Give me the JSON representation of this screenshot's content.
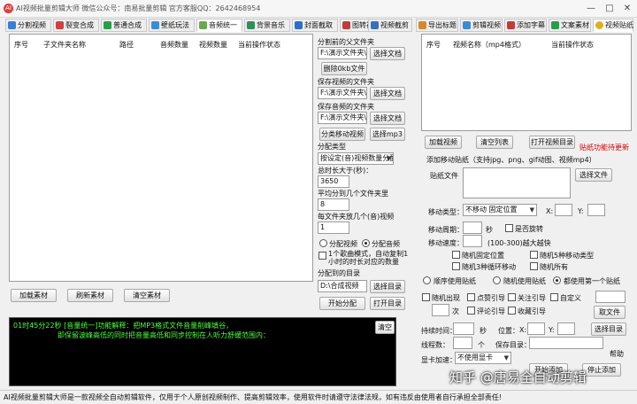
{
  "window": {
    "title": "AI视频批量剪辑大师   微信公众号：南易批量剪辑   官方客服QQ：2642468954",
    "min": "—",
    "max": "□",
    "close": "✕"
  },
  "left_tabs": [
    "分割视频",
    "裂变合成",
    "普通合成",
    "壁纸玩法",
    "音频统一",
    "背景音乐",
    "封面截取",
    "图转视频",
    "视频截剪"
  ],
  "right_tabs": [
    "导出标题",
    "剪辑视频",
    "添加字幕",
    "文案素材",
    "视频贴纸"
  ],
  "file_table": {
    "headers": [
      "序号",
      "子文件夹名称",
      "路径",
      "音频数量",
      "视频数量",
      "当前操作状态"
    ]
  },
  "left_buttons": {
    "add": "加载素材",
    "refresh": "刷新素材",
    "clear": "清空素材"
  },
  "config": {
    "split_folder_label": "分割前的父文件夹",
    "split_folder_value": "F:\\演示文件夹\\割",
    "select": "选择文档",
    "delete_btn": "删除0kb文件",
    "save_video_label": "保存视频的文件夹",
    "save_video_value": "F:\\演示文件夹\\割",
    "save_audio_label": "保存音频的文件夹",
    "save_audio_value": "F:\\演示文件夹\\",
    "classify_btn": "分类移动视频",
    "select_mp3": "选择mp3",
    "split_type_label": "分配类型",
    "split_type_value": "按设定(音)视频数量分配",
    "total_len_label": "总时长大于(秒)：",
    "total_len_value": "3650",
    "avg_label": "平均分到几个文件夹里",
    "avg_value": "8",
    "per_label": "每文件夹放几个(音)视频",
    "per_value": "1",
    "radio_video": "分配视频",
    "radio_audio": "分配音频",
    "mode_note": "1个歌曲模式，自动复制1小时的时长对应的数量",
    "dir_label": "分配到的目录",
    "dir_value": "D:\\合成视频",
    "select_dir": "选择目录",
    "start_btn": "开始分配",
    "open_dir": "打开目录"
  },
  "log": {
    "line1": "01时45分22秒 [音量统一]功能解释：把MP3格式文件音量削峰填谷，",
    "line2": "即保留波峰高低的同时把音量高低和同步控制在人听力舒缓范围内：",
    "clear": "清空"
  },
  "sticker": {
    "headers": [
      "序号",
      "视频名称（mp4格式）",
      "当前操作状态"
    ],
    "load_btn": "加载视频",
    "clear_btn": "清空列表",
    "open_dir_btn": "打开视频目录",
    "notice": "贴纸功能待更新",
    "add_title": "添加移动贴纸（支持jpg、png、gif动图、视频mp4）",
    "sticker_file_label": "贴纸文件",
    "select_file": "选择文件",
    "move_type_label": "移动类型：",
    "move_type_value": "不移动 固定位置",
    "x_label": "X:",
    "y_label": "Y:",
    "move_period_label": "移动周期：",
    "seconds": "秒",
    "rotate": "是否旋转",
    "move_speed_label": "移动速度：",
    "speed_hint": "(100-300)越大越快",
    "random_fixed": "随机固定位置",
    "random5": "随机5种移动类型",
    "random3": "随机3种循环移动",
    "random_all": "随机所有",
    "seq": "顺序使用贴纸",
    "random_use": "随机使用贴纸",
    "all_first": "都使用第一个贴纸",
    "random_show": "随机出现",
    "like": "点赞引导",
    "follow": "关注引导",
    "custom": "自定义",
    "times": "次",
    "comment": "评论引导",
    "fav": "收藏引导",
    "take_file": "取文件",
    "duration_label": "持续时间：",
    "sec2": "秒",
    "pos_label": "位置：",
    "x2": "X:",
    "y2": "Y:",
    "select_dir": "选择目录",
    "threads_label": "线程数：",
    "count_unit": "个",
    "save_dir_label": "保存目录：",
    "help": "帮助",
    "gpu_label": "显卡加速：",
    "gpu_value": "不使用显卡",
    "start": "开始添加",
    "stop": "停止添加"
  },
  "status": "AI视频批量剪辑大师是一款视频全自动剪辑软件，仅用于个人原创视频制作、提高剪辑效率，使用软件时请遵守法律法规，如有违反由使用者自行承担全部责任!",
  "watermark": "知乎 @唐易全自动剪辑"
}
